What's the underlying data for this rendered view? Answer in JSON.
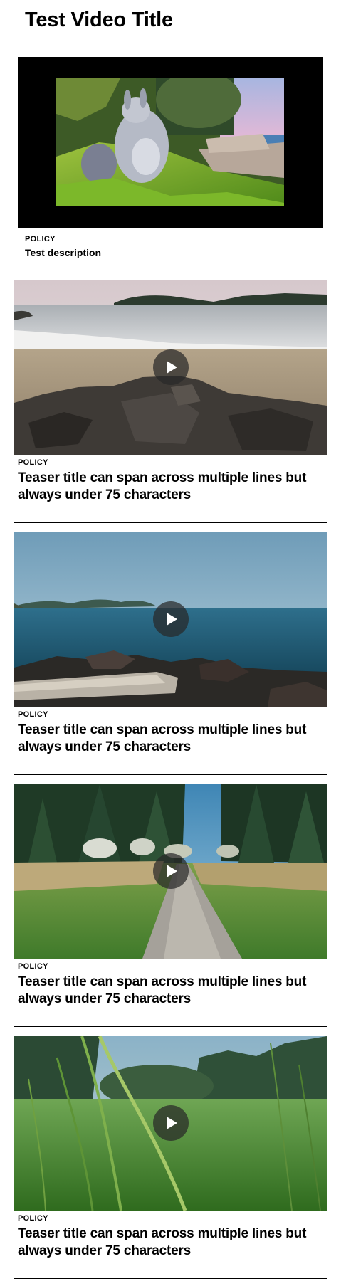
{
  "page": {
    "title": "Test Video Title"
  },
  "main_video": {
    "eyebrow": "POLICY",
    "description": "Test description",
    "frame_icon": "video-frame-animated-character"
  },
  "teasers": [
    {
      "eyebrow": "POLICY",
      "title": "Teaser title can span across multiple lines but always under 75 characters",
      "thumbnail": "beach-rocks",
      "play_icon": "play-icon"
    },
    {
      "eyebrow": "POLICY",
      "title": "Teaser title can span across multiple lines but always under 75 characters",
      "thumbnail": "sea-driftwood",
      "play_icon": "play-icon"
    },
    {
      "eyebrow": "POLICY",
      "title": "Teaser title can span across multiple lines but always under 75 characters",
      "thumbnail": "forest-path",
      "play_icon": "play-icon"
    },
    {
      "eyebrow": "POLICY",
      "title": "Teaser title can span across multiple lines but always under 75 characters",
      "thumbnail": "grass-field",
      "play_icon": "play-icon"
    }
  ],
  "colors": {
    "text": "#000000",
    "background": "#ffffff",
    "player_background": "#000000",
    "play_button": "#282828"
  }
}
